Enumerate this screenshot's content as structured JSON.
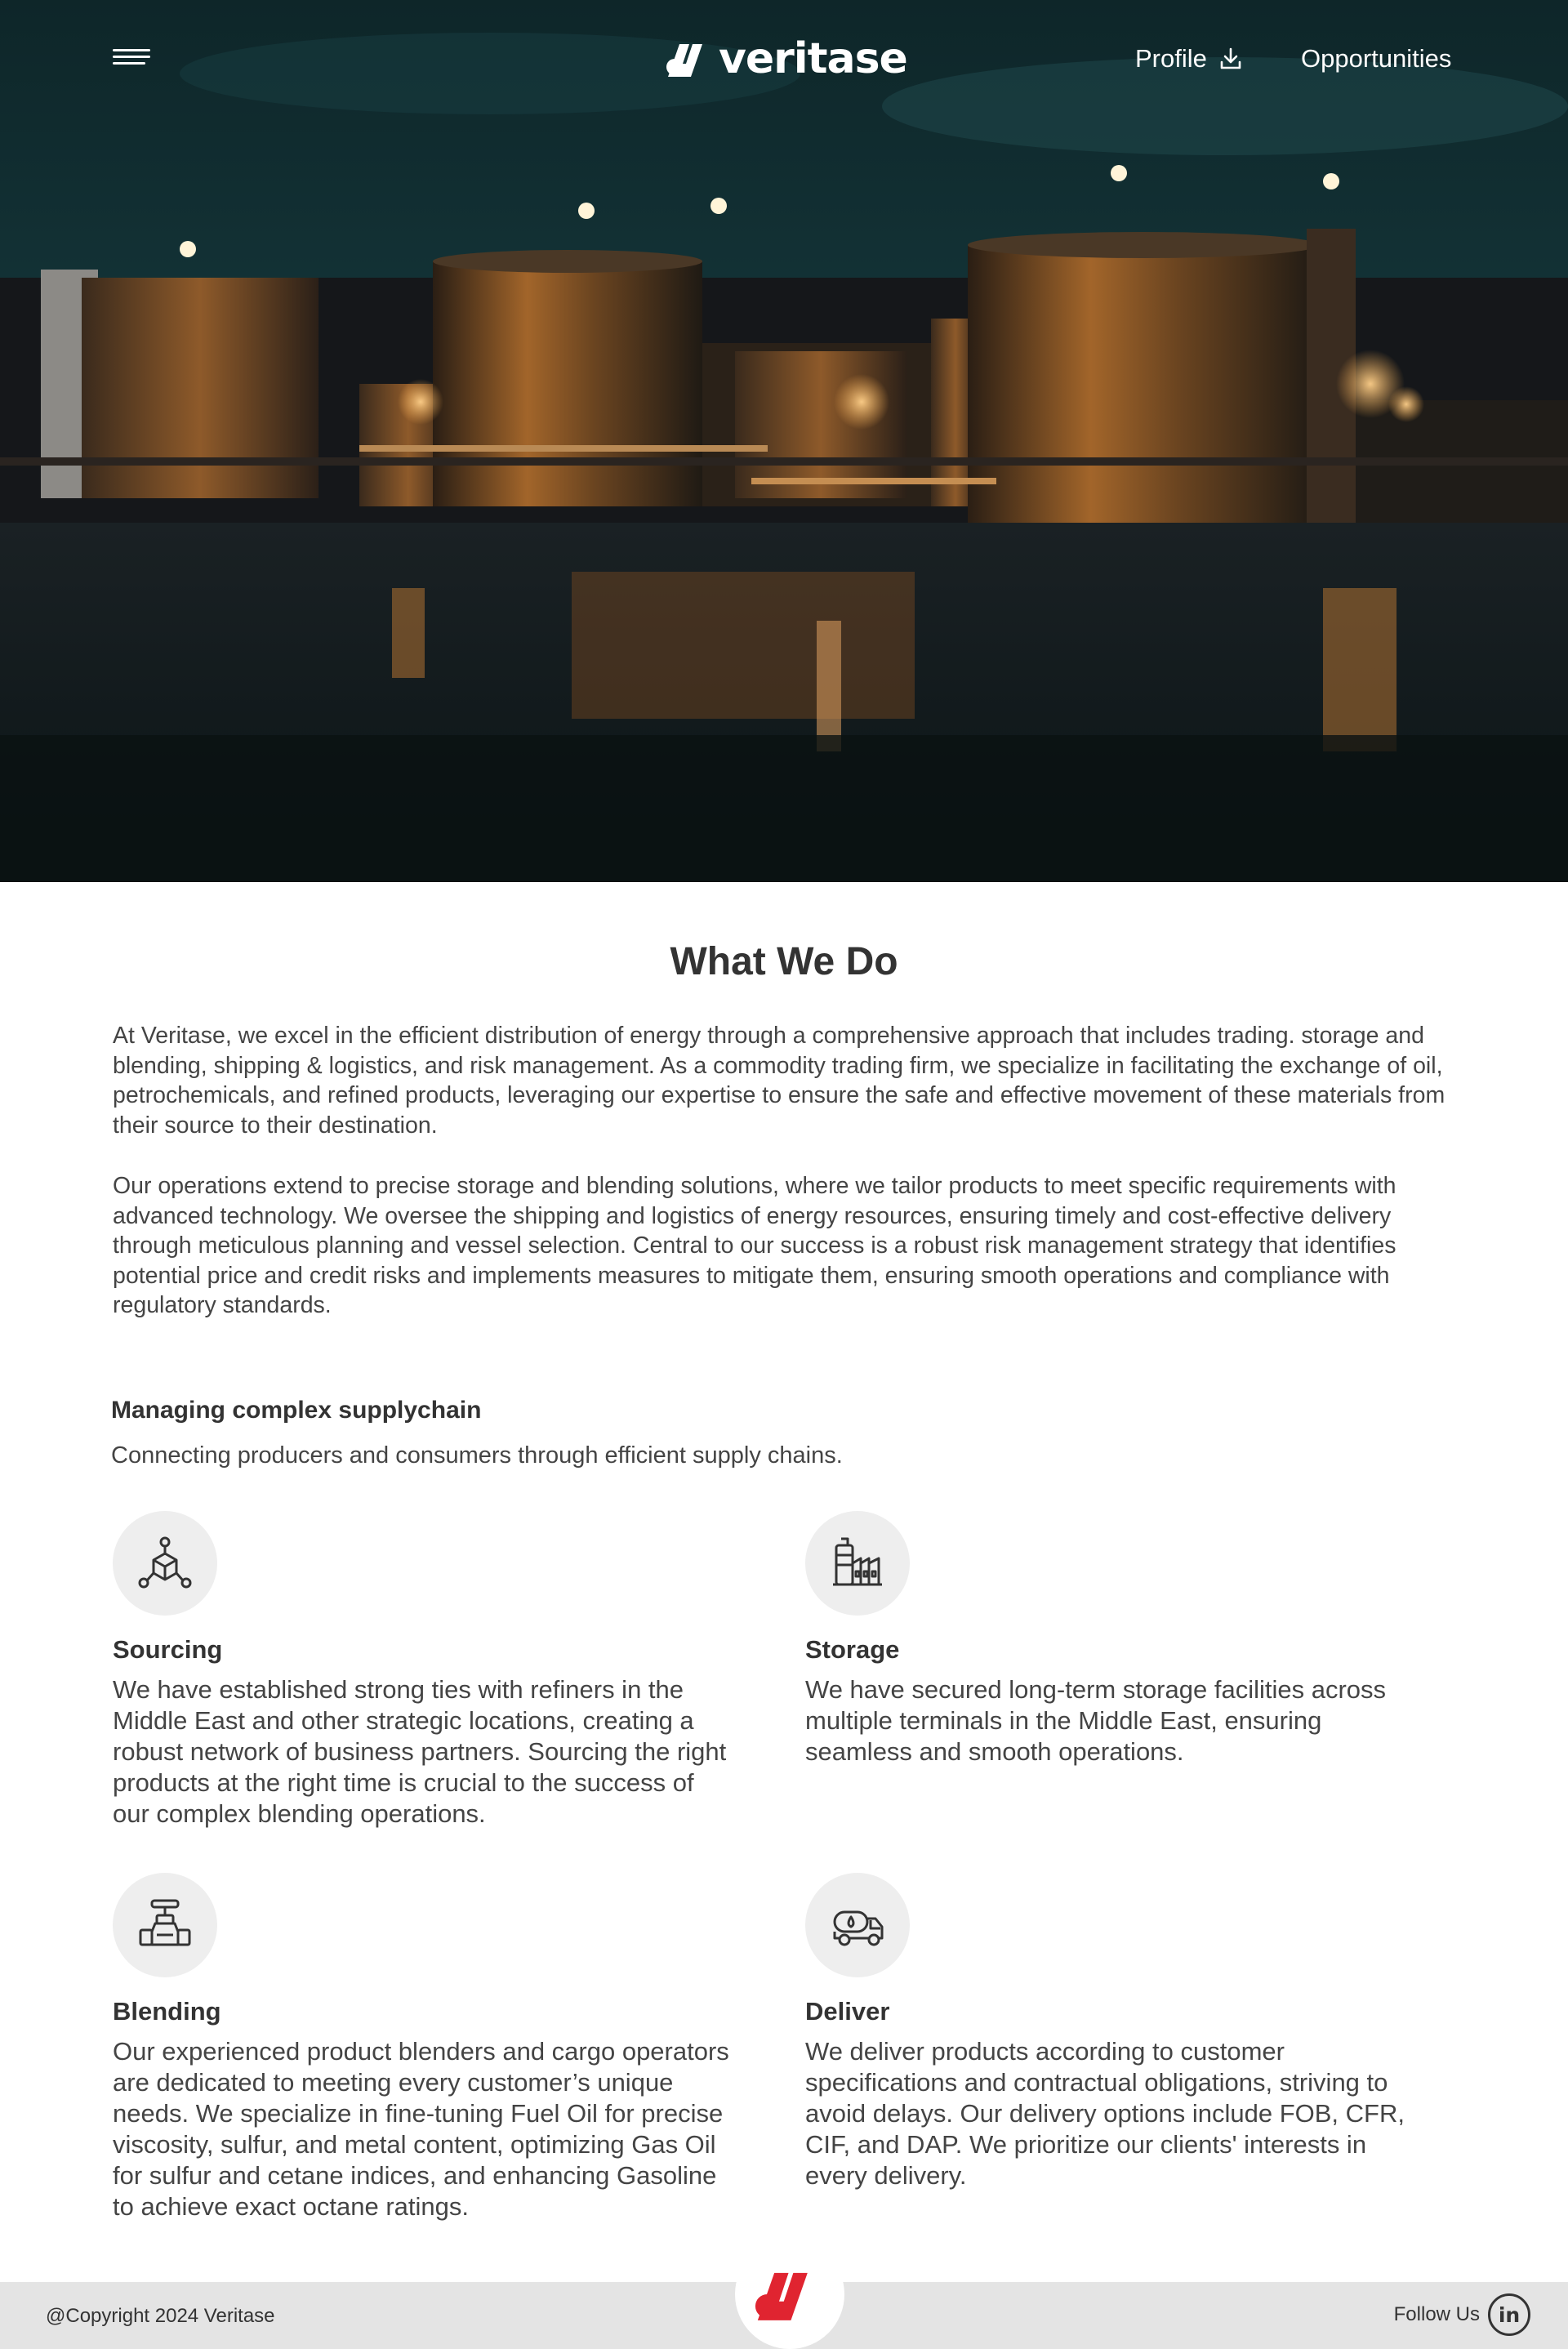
{
  "colors": {
    "brand_red": "#e02430",
    "hero_teal": "#0f2a2e",
    "light_accent": "#e8a24a"
  },
  "nav": {
    "menu_icon": "hamburger-menu-icon",
    "logo_text": "veritase",
    "profile_label": "Profile",
    "profile_icon": "download-icon",
    "opportunities_label": "Opportunities"
  },
  "main": {
    "title": "What We Do",
    "paragraphs": [
      "At Veritase, we excel in the efficient distribution of energy through a comprehensive approach that includes trading. storage and blending, shipping & logistics, and risk management. As a commodity trading firm, we specialize in facilitating the exchange of oil, petrochemicals, and refined products, leveraging our expertise to ensure the safe and effective movement of these materials from their source to their destination.",
      "Our operations extend to precise storage and blending solutions, where we tailor products to meet specific requirements with advanced technology. We oversee the shipping and logistics of energy resources, ensuring timely and cost-effective delivery through meticulous planning and vessel selection. Central to our success is a robust risk management strategy that identifies potential price and credit risks and implements measures to mitigate them, ensuring smooth operations and compliance with regulatory standards."
    ],
    "supply_heading": "Managing complex supplychain",
    "supply_sub": "Connecting producers and consumers through efficient supply chains.",
    "features": [
      {
        "icon": "network-cube-icon",
        "title": "Sourcing",
        "desc": "We have established strong ties with refiners in the Middle East and other strategic locations, creating a robust network of business partners. Sourcing the right products at the right time is crucial to the success of our complex blending operations."
      },
      {
        "icon": "storage-facility-icon",
        "title": "Storage",
        "desc": "We have secured long-term storage facilities across multiple terminals in the Middle East, ensuring seamless and smooth operations."
      },
      {
        "icon": "valve-pipe-icon",
        "title": "Blending",
        "desc": "Our experienced product blenders and cargo operators are dedicated to meeting every customer’s unique needs. We specialize in fine-tuning Fuel Oil for precise viscosity, sulfur, and metal content, optimizing Gas Oil for sulfur and cetane indices, and enhancing Gasoline to achieve exact octane ratings."
      },
      {
        "icon": "tanker-truck-icon",
        "title": "Deliver",
        "desc": "We deliver products according to customer specifications and contractual obligations, striving to avoid delays. Our delivery options include FOB, CFR, CIF, and DAP. We prioritize our clients' interests in every delivery."
      }
    ]
  },
  "footer": {
    "copyright": "@Copyright 2024 Veritase",
    "follow_label": "Follow Us",
    "linkedin_text": "in"
  }
}
